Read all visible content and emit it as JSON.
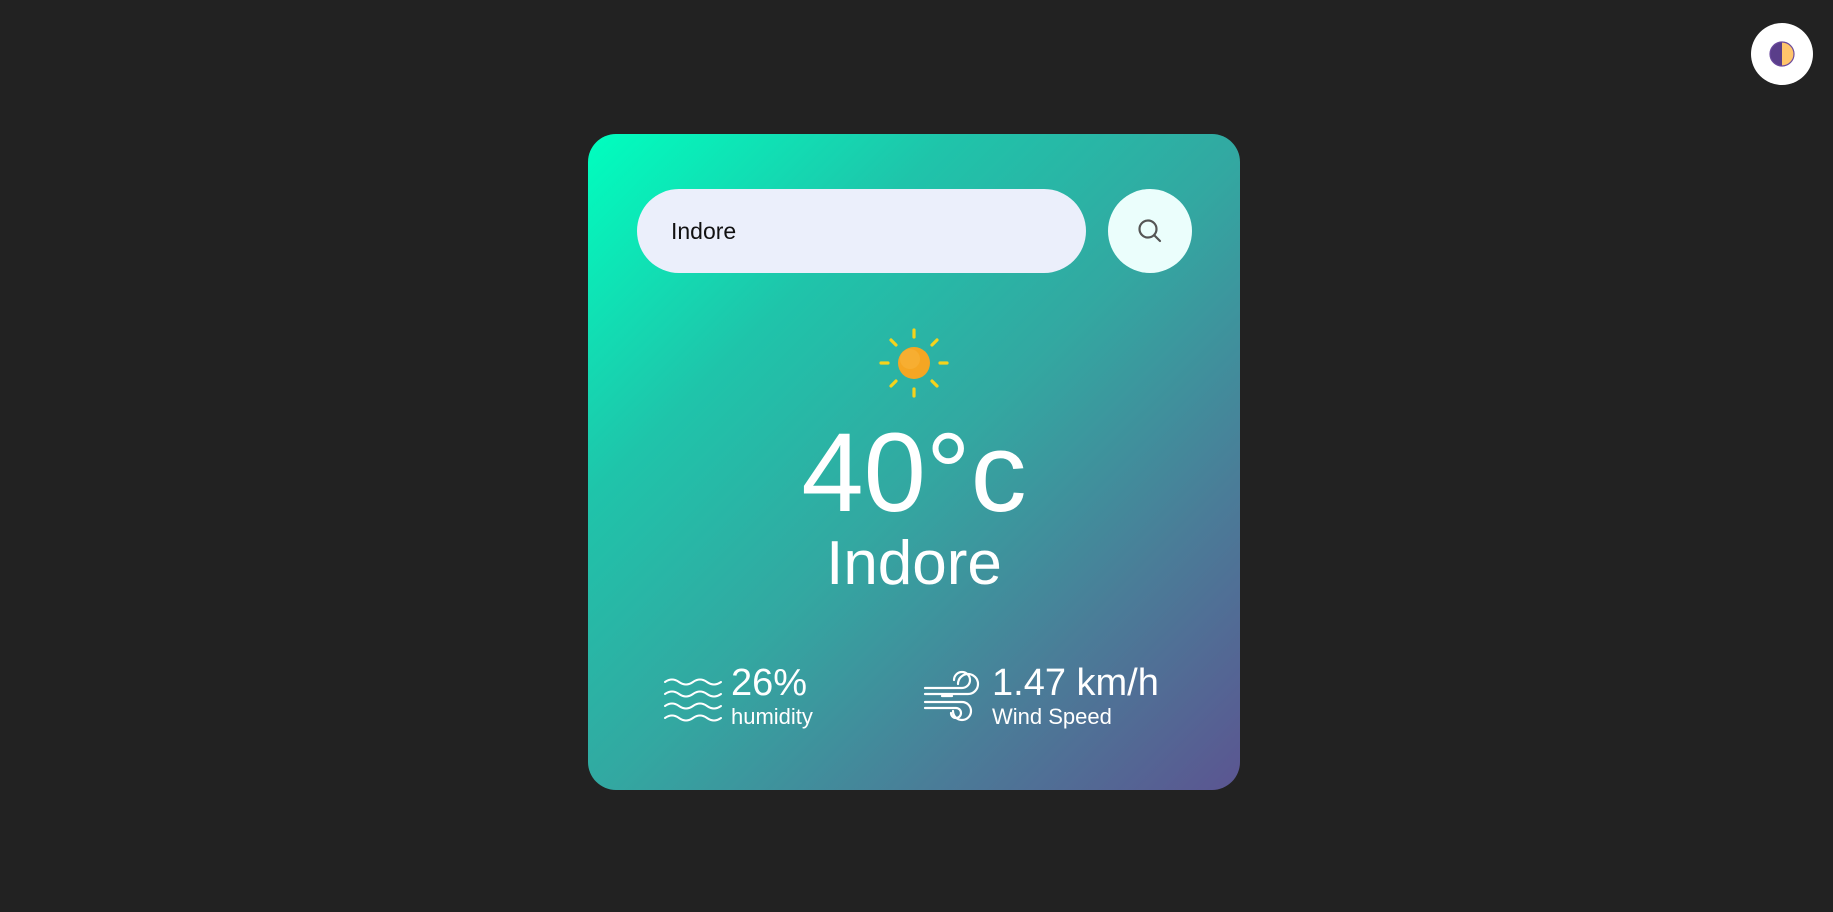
{
  "theme_toggle": {
    "icon": "half-moon-contrast-icon"
  },
  "search": {
    "value": "Indore",
    "button_icon": "search-icon"
  },
  "weather": {
    "icon": "sun-icon",
    "temperature": "40°c",
    "city": "Indore"
  },
  "details": {
    "humidity": {
      "icon": "water-waves-icon",
      "value": "26%",
      "label": "humidity"
    },
    "wind": {
      "icon": "wind-icon",
      "value": "1.47 km/h",
      "label": "Wind Speed"
    }
  },
  "colors": {
    "background": "#222222",
    "card_gradient_start": "#00ffbf",
    "card_gradient_end": "#5b5591",
    "sun": "#f5a623",
    "sun_rays": "#f6d31b"
  }
}
